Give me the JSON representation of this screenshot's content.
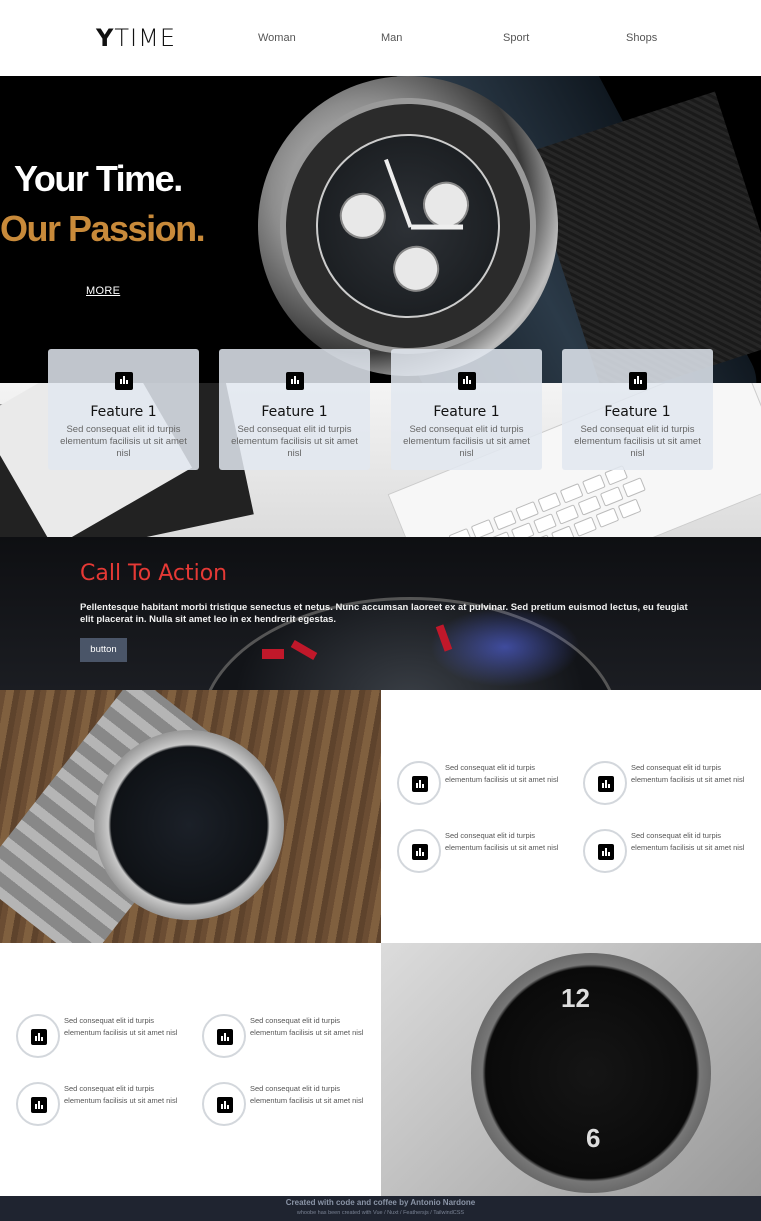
{
  "brand": {
    "logo_bold": "Y",
    "logo_rest": "TIME"
  },
  "nav": {
    "items": [
      "Woman",
      "Man",
      "Sport",
      "Shops"
    ]
  },
  "hero": {
    "line1": "Your Time.",
    "line2": "Our Passion.",
    "more_label": "MORE",
    "accent_color": "#c88a3a"
  },
  "features": [
    {
      "icon": "bar-chart-icon",
      "title": "Feature 1",
      "text": "Sed consequat elit id turpis elementum facilisis ut sit amet nisl"
    },
    {
      "icon": "bar-chart-icon",
      "title": "Feature 1",
      "text": "Sed consequat elit id turpis elementum facilisis ut sit amet nisl"
    },
    {
      "icon": "bar-chart-icon",
      "title": "Feature 1",
      "text": "Sed consequat elit id turpis elementum facilisis ut sit amet nisl"
    },
    {
      "icon": "bar-chart-icon",
      "title": "Feature 1",
      "text": "Sed consequat elit id turpis elementum facilisis ut sit amet nisl"
    }
  ],
  "cta": {
    "title": "Call To Action",
    "title_color": "#e53935",
    "body": "Pellentesque habitant morbi tristique senectus et netus. Nunc accumsan laoreet ex at pulvinar. Sed pretium euismod lectus, eu feugiat elit placerat in. Nulla sit amet leo in ex hendrerit egestas.",
    "button_label": "button"
  },
  "grid_block_1": [
    {
      "icon": "bar-chart-icon",
      "text": "Sed consequat elit id turpis elementum facilisis ut sit amet nisl"
    },
    {
      "icon": "bar-chart-icon",
      "text": "Sed consequat elit id turpis elementum facilisis ut sit amet nisl"
    },
    {
      "icon": "bar-chart-icon",
      "text": "Sed consequat elit id turpis elementum facilisis ut sit amet nisl"
    },
    {
      "icon": "bar-chart-icon",
      "text": "Sed consequat elit id turpis elementum facilisis ut sit amet nisl"
    }
  ],
  "grid_block_2": [
    {
      "icon": "bar-chart-icon",
      "text": "Sed consequat elit id turpis elementum facilisis ut sit amet nisl"
    },
    {
      "icon": "bar-chart-icon",
      "text": "Sed consequat elit id turpis elementum facilisis ut sit amet nisl"
    },
    {
      "icon": "bar-chart-icon",
      "text": "Sed consequat elit id turpis elementum facilisis ut sit amet nisl"
    },
    {
      "icon": "bar-chart-icon",
      "text": "Sed consequat elit id turpis elementum facilisis ut sit amet nisl"
    }
  ],
  "footer": {
    "line1": "Created with code and coffee by Antonio Nardone",
    "line2": "whoobe has been created with Vue / Nuxt / Feathersjs / TailwindCSS",
    "bg_color": "#1f2430"
  }
}
